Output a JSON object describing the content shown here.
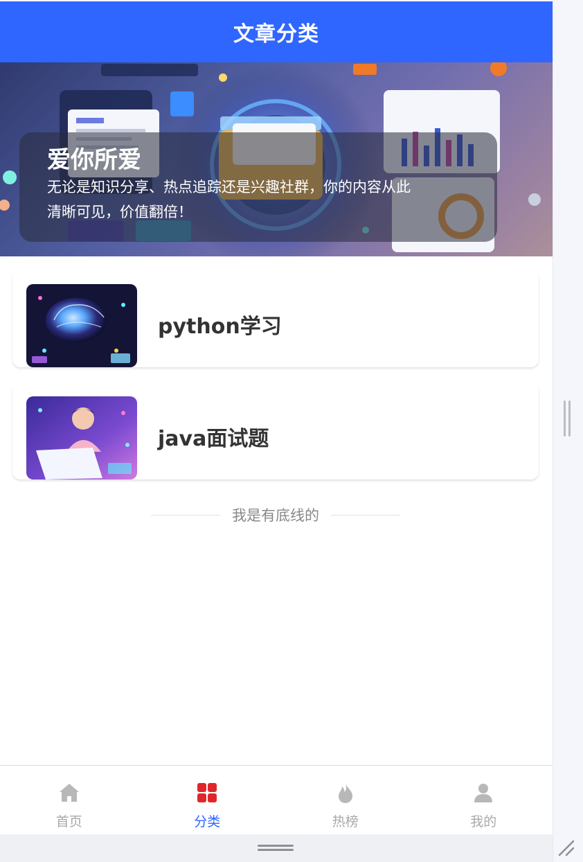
{
  "header": {
    "title": "文章分类"
  },
  "banner": {
    "title": "爱你所爱",
    "subtitle_line1": "无论是知识分享、热点追踪还是兴趣社群，你的内容从此",
    "subtitle_line2": "清晰可见，价值翻倍！"
  },
  "categories": [
    {
      "label": "python学习",
      "thumb": "brain-illustration"
    },
    {
      "label": "java面试题",
      "thumb": "coder-laptop-illustration"
    }
  ],
  "list_end": {
    "text": "我是有底线的"
  },
  "tabbar": {
    "items": [
      {
        "label": "首页",
        "icon": "home-icon",
        "active": false
      },
      {
        "label": "分类",
        "icon": "category-grid-icon",
        "active": true
      },
      {
        "label": "热榜",
        "icon": "flame-icon",
        "active": false
      },
      {
        "label": "我的",
        "icon": "user-icon",
        "active": false
      }
    ],
    "active_color": "#2f66ff",
    "inactive_color": "#a8a8a8"
  },
  "colors": {
    "brand": "#2f66ff",
    "active_category_icon": "#e0262b"
  }
}
